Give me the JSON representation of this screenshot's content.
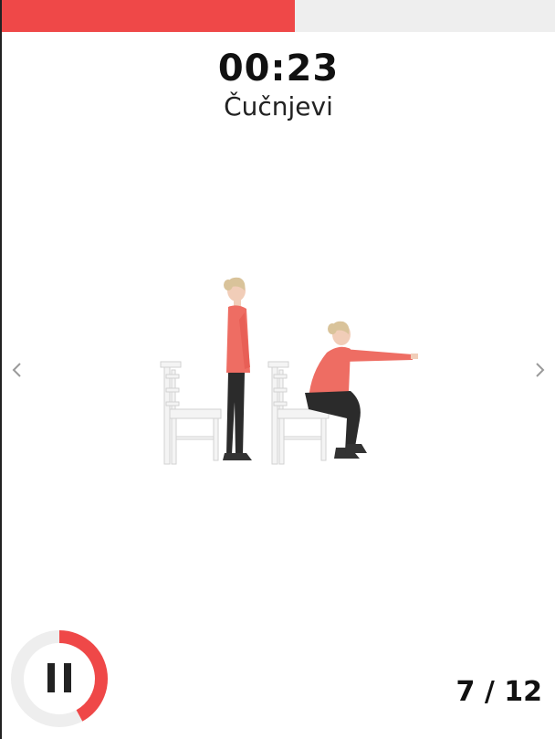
{
  "timer": "00:23",
  "exercise": {
    "name": "Čučnjevi"
  },
  "progress": {
    "fraction": 0.53,
    "fill_color": "#ef4848",
    "track_color": "#eeeeee"
  },
  "navigation": {
    "prev_icon": "chevron-left-icon",
    "next_icon": "chevron-right-icon"
  },
  "pause": {
    "icon": "pause-icon",
    "countdown_fraction": 0.42,
    "ring_color": "#ef4848",
    "ring_track_color": "#eeeeee"
  },
  "counter": {
    "current": "7",
    "separator": "/",
    "total": "12"
  }
}
